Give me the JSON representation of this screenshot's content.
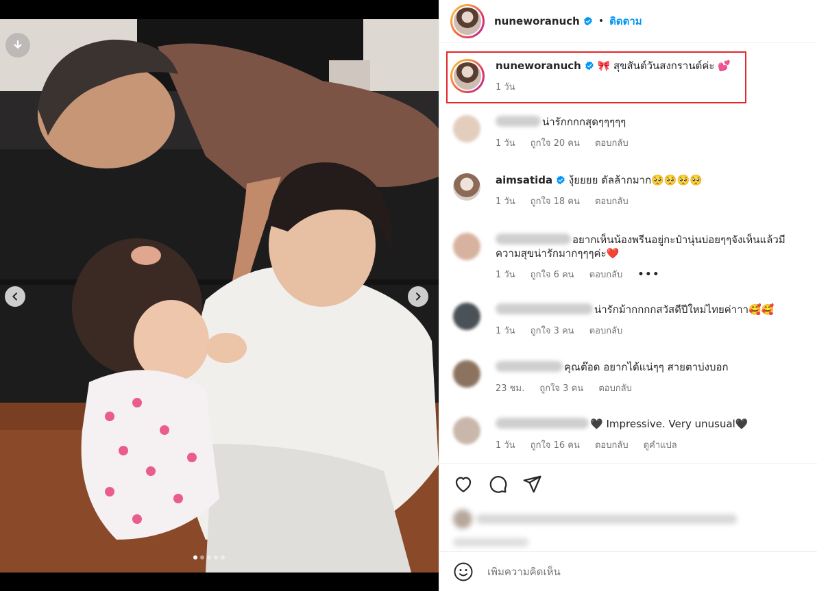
{
  "header": {
    "username": "nuneworanuch",
    "separator": "•",
    "follow_label": "ติดตาม"
  },
  "caption": {
    "username": "nuneworanuch",
    "text": "🎀 สุขสันต์วันสงกรานต์ค่ะ 💕",
    "time": "1 วัน"
  },
  "comments": [
    {
      "username": "",
      "text": "น่ารักกกกสุดๆๆๆๆๆ",
      "time": "1 วัน",
      "likes": "ถูกใจ 20 คน",
      "reply": "ตอบกลับ"
    },
    {
      "username": "aimsatida",
      "text": "งุ้ยยยย ดัลล้ากมาก🥺🥺🥺🥺",
      "time": "1 วัน",
      "likes": "ถูกใจ 18 คน",
      "reply": "ตอบกลับ"
    },
    {
      "username": "",
      "text": "อยากเห็นน้องพรีนอยู่กะป๋านุ่นบ่อยๆๆจังเห็นแล้วมีความสุขน่ารักมากๆๆๆค่ะ❤️",
      "time": "1 วัน",
      "likes": "ถูกใจ 6 คน",
      "reply": "ตอบกลับ",
      "more": "•••"
    },
    {
      "username": "",
      "text": "น่ารักม้ากกกกสวัสดีปีใหม่ไทยค่าาา🥰🥰",
      "time": "1 วัน",
      "likes": "ถูกใจ 3 คน",
      "reply": "ตอบกลับ"
    },
    {
      "username": "",
      "text": "คุณต๊อด อยากได้แน่ๆๆ สายตาบ่งบอก",
      "time": "23 ชม.",
      "likes": "ถูกใจ 3 คน",
      "reply": "ตอบกลับ"
    },
    {
      "username": "",
      "text": "🖤 Impressive. Very unusual🖤",
      "time": "1 วัน",
      "likes": "ถูกใจ 16 คน",
      "reply": "ตอบกลับ",
      "translate": "ดูคำแปล"
    }
  ],
  "composer": {
    "placeholder": "เพิ่มความคิดเห็น"
  },
  "icons": {
    "download": "download-icon",
    "prev": "chevron-left-icon",
    "next": "chevron-right-icon",
    "like": "heart-icon",
    "comment": "comment-icon",
    "share": "send-icon",
    "emoji": "emoji-icon",
    "verified": "verified-badge-icon"
  },
  "carousel": {
    "total": 5,
    "active": 1
  },
  "colors": {
    "accent": "#0095f6",
    "highlight_box": "#e3262b",
    "verified": "#0095f6"
  }
}
